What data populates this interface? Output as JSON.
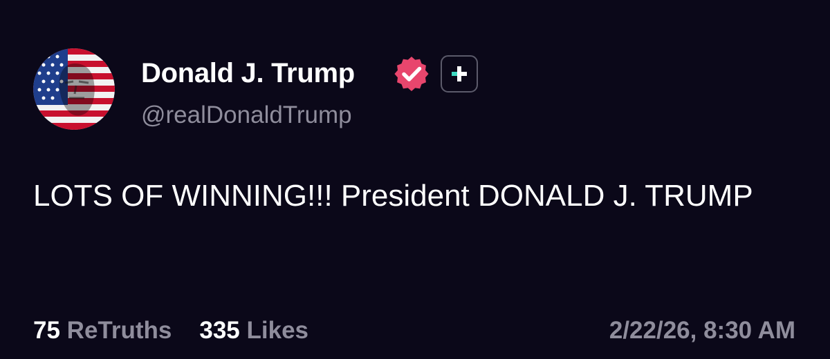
{
  "author": {
    "display_name": "Donald J. Trump",
    "handle": "@realDonaldTrump",
    "avatar_icon": "american-flag-portrait-avatar",
    "verified_icon": "verified-badge-icon",
    "plus_icon": "plus-badge-icon"
  },
  "post": {
    "text": "LOTS OF WINNING!!! President DONALD J. TRUMP"
  },
  "stats": {
    "retruths_count": "75",
    "retruths_label": "ReTruths",
    "likes_count": "335",
    "likes_label": "Likes"
  },
  "timestamp": "2/22/26, 8:30 AM",
  "colors": {
    "background": "#0b0819",
    "text_primary": "#ffffff",
    "text_secondary": "#8f8d9c",
    "verified_badge": "#e8466d",
    "plus_accent": "#3fd9c3"
  }
}
